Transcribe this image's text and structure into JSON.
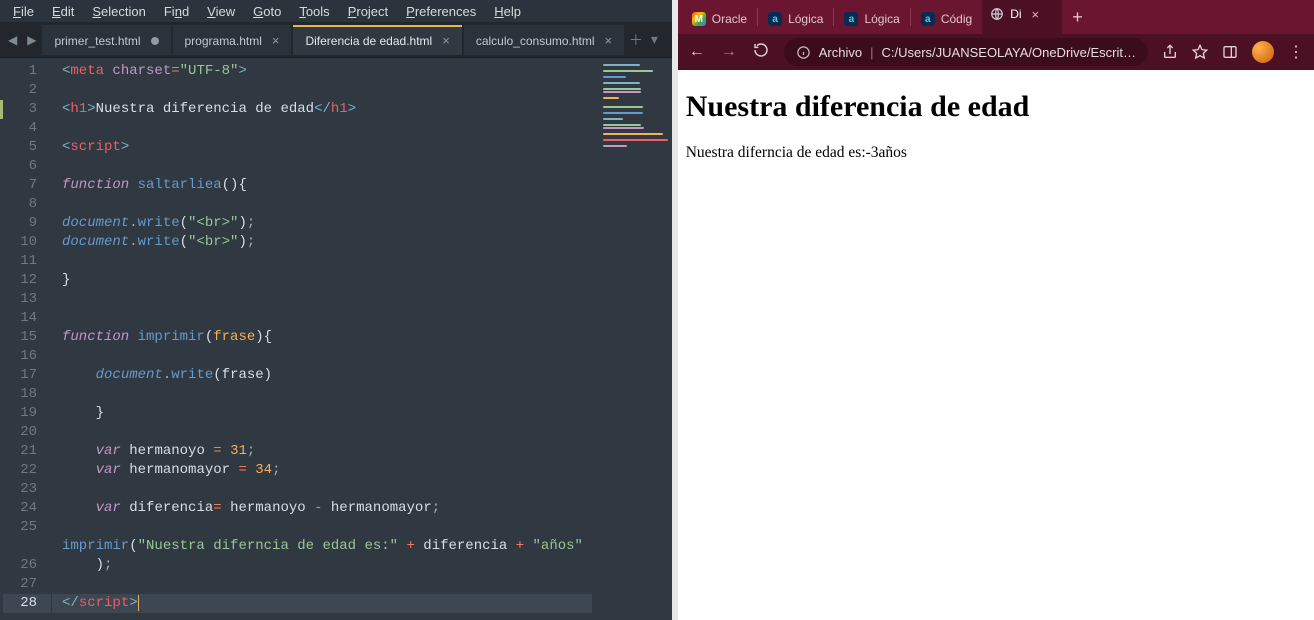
{
  "sublime": {
    "menu": [
      "File",
      "Edit",
      "Selection",
      "Find",
      "View",
      "Goto",
      "Tools",
      "Project",
      "Preferences",
      "Help"
    ],
    "menu_underline": [
      0,
      0,
      0,
      2,
      0,
      0,
      0,
      0,
      0,
      0
    ],
    "tabs": [
      {
        "label": "primer_test.html",
        "dirty": true,
        "active": false
      },
      {
        "label": "programa.html",
        "dirty": false,
        "active": false
      },
      {
        "label": "Diferencia de edad.html",
        "dirty": false,
        "active": true
      },
      {
        "label": "calculo_consumo.html",
        "dirty": false,
        "active": false
      }
    ],
    "code": {
      "line_count": 28,
      "cursor_line": 28,
      "tokens": [
        [
          {
            "t": "<",
            "c": "tagp"
          },
          {
            "t": "meta",
            "c": "tagn"
          },
          {
            "t": " ",
            "c": "white"
          },
          {
            "t": "charset",
            "c": "attr"
          },
          {
            "t": "=",
            "c": "op"
          },
          {
            "t": "\"UTF-8\"",
            "c": "str"
          },
          {
            "t": ">",
            "c": "tagp"
          }
        ],
        [],
        [
          {
            "t": "<",
            "c": "tagp"
          },
          {
            "t": "h1",
            "c": "tagn"
          },
          {
            "t": ">",
            "c": "tagp"
          },
          {
            "t": "Nuestra diferencia de edad",
            "c": "white"
          },
          {
            "t": "</",
            "c": "tagp"
          },
          {
            "t": "h1",
            "c": "tagn"
          },
          {
            "t": ">",
            "c": "tagp"
          }
        ],
        [],
        [
          {
            "t": "<",
            "c": "tagp"
          },
          {
            "t": "script",
            "c": "tagn"
          },
          {
            "t": ">",
            "c": "tagp"
          }
        ],
        [],
        [
          {
            "t": "function",
            "c": "kw"
          },
          {
            "t": " ",
            "c": "white"
          },
          {
            "t": "saltarliea",
            "c": "fn"
          },
          {
            "t": "()",
            "c": "white"
          },
          {
            "t": "{",
            "c": "white"
          }
        ],
        [],
        [
          {
            "t": "document",
            "c": "obj"
          },
          {
            "t": ".",
            "c": "pnc"
          },
          {
            "t": "write",
            "c": "fn"
          },
          {
            "t": "(",
            "c": "white"
          },
          {
            "t": "\"<br>\"",
            "c": "str"
          },
          {
            "t": ")",
            "c": "white"
          },
          {
            "t": ";",
            "c": "pnc"
          }
        ],
        [
          {
            "t": "document",
            "c": "obj"
          },
          {
            "t": ".",
            "c": "pnc"
          },
          {
            "t": "write",
            "c": "fn"
          },
          {
            "t": "(",
            "c": "white"
          },
          {
            "t": "\"<br>\"",
            "c": "str"
          },
          {
            "t": ")",
            "c": "white"
          },
          {
            "t": ";",
            "c": "pnc"
          }
        ],
        [],
        [
          {
            "t": "}",
            "c": "white"
          }
        ],
        [],
        [],
        [
          {
            "t": "function",
            "c": "kw"
          },
          {
            "t": " ",
            "c": "white"
          },
          {
            "t": "imprimir",
            "c": "fn"
          },
          {
            "t": "(",
            "c": "white"
          },
          {
            "t": "frase",
            "c": "prm"
          },
          {
            "t": ")",
            "c": "white"
          },
          {
            "t": "{",
            "c": "white"
          }
        ],
        [],
        [
          {
            "t": "    ",
            "c": "white"
          },
          {
            "t": "document",
            "c": "obj"
          },
          {
            "t": ".",
            "c": "pnc"
          },
          {
            "t": "write",
            "c": "fn"
          },
          {
            "t": "(",
            "c": "white"
          },
          {
            "t": "frase",
            "c": "white"
          },
          {
            "t": ")",
            "c": "white"
          }
        ],
        [],
        [
          {
            "t": "    }",
            "c": "white"
          }
        ],
        [],
        [
          {
            "t": "    ",
            "c": "white"
          },
          {
            "t": "var",
            "c": "kw"
          },
          {
            "t": " ",
            "c": "white"
          },
          {
            "t": "hermanoyo",
            "c": "white"
          },
          {
            "t": " ",
            "c": "white"
          },
          {
            "t": "=",
            "c": "op"
          },
          {
            "t": " ",
            "c": "white"
          },
          {
            "t": "31",
            "c": "num"
          },
          {
            "t": ";",
            "c": "pnc"
          }
        ],
        [
          {
            "t": "    ",
            "c": "white"
          },
          {
            "t": "var",
            "c": "kw"
          },
          {
            "t": " ",
            "c": "white"
          },
          {
            "t": "hermanomayor",
            "c": "white"
          },
          {
            "t": " ",
            "c": "white"
          },
          {
            "t": "=",
            "c": "op"
          },
          {
            "t": " ",
            "c": "white"
          },
          {
            "t": "34",
            "c": "num"
          },
          {
            "t": ";",
            "c": "pnc"
          }
        ],
        [],
        [
          {
            "t": "    ",
            "c": "white"
          },
          {
            "t": "var",
            "c": "kw"
          },
          {
            "t": " ",
            "c": "white"
          },
          {
            "t": "diferencia",
            "c": "white"
          },
          {
            "t": "=",
            "c": "op"
          },
          {
            "t": " ",
            "c": "white"
          },
          {
            "t": "hermanoyo",
            "c": "white"
          },
          {
            "t": " ",
            "c": "white"
          },
          {
            "t": "-",
            "c": "op"
          },
          {
            "t": " ",
            "c": "white"
          },
          {
            "t": "hermanomayor",
            "c": "white"
          },
          {
            "t": ";",
            "c": "pnc"
          }
        ],
        [],
        [
          {
            "t": "imprimir",
            "c": "fn"
          },
          {
            "t": "(",
            "c": "white"
          },
          {
            "t": "\"Nuestra diferncia de edad es:\"",
            "c": "str"
          },
          {
            "t": " ",
            "c": "white"
          },
          {
            "t": "+",
            "c": "op"
          },
          {
            "t": " ",
            "c": "white"
          },
          {
            "t": "diferencia",
            "c": "white"
          },
          {
            "t": " ",
            "c": "white"
          },
          {
            "t": "+",
            "c": "op"
          },
          {
            "t": " ",
            "c": "white"
          },
          {
            "t": "\"años\"",
            "c": "str"
          },
          {
            "t": "\n    )",
            "c": "white"
          },
          {
            "t": ";",
            "c": "pnc"
          }
        ],
        [],
        [
          {
            "t": "</",
            "c": "tagp"
          },
          {
            "t": "script",
            "c": "tagn"
          },
          {
            "t": ">",
            "c": "tagp"
          }
        ]
      ]
    }
  },
  "chrome": {
    "tabs": [
      {
        "type": "gmail",
        "label": "Oracle"
      },
      {
        "type": "alura",
        "label": "Lógica"
      },
      {
        "type": "alura",
        "label": "Lógica"
      },
      {
        "type": "alura",
        "label": "Códig"
      },
      {
        "type": "page",
        "label": "Di",
        "active": true
      }
    ],
    "omnibox_prefix": "Archivo",
    "omnibox_path": "C:/Users/JUANSEOLAYA/OneDrive/Escrit…",
    "page": {
      "heading": "Nuestra diferencia de edad",
      "body": "Nuestra diferncia de edad es:-3años"
    }
  }
}
